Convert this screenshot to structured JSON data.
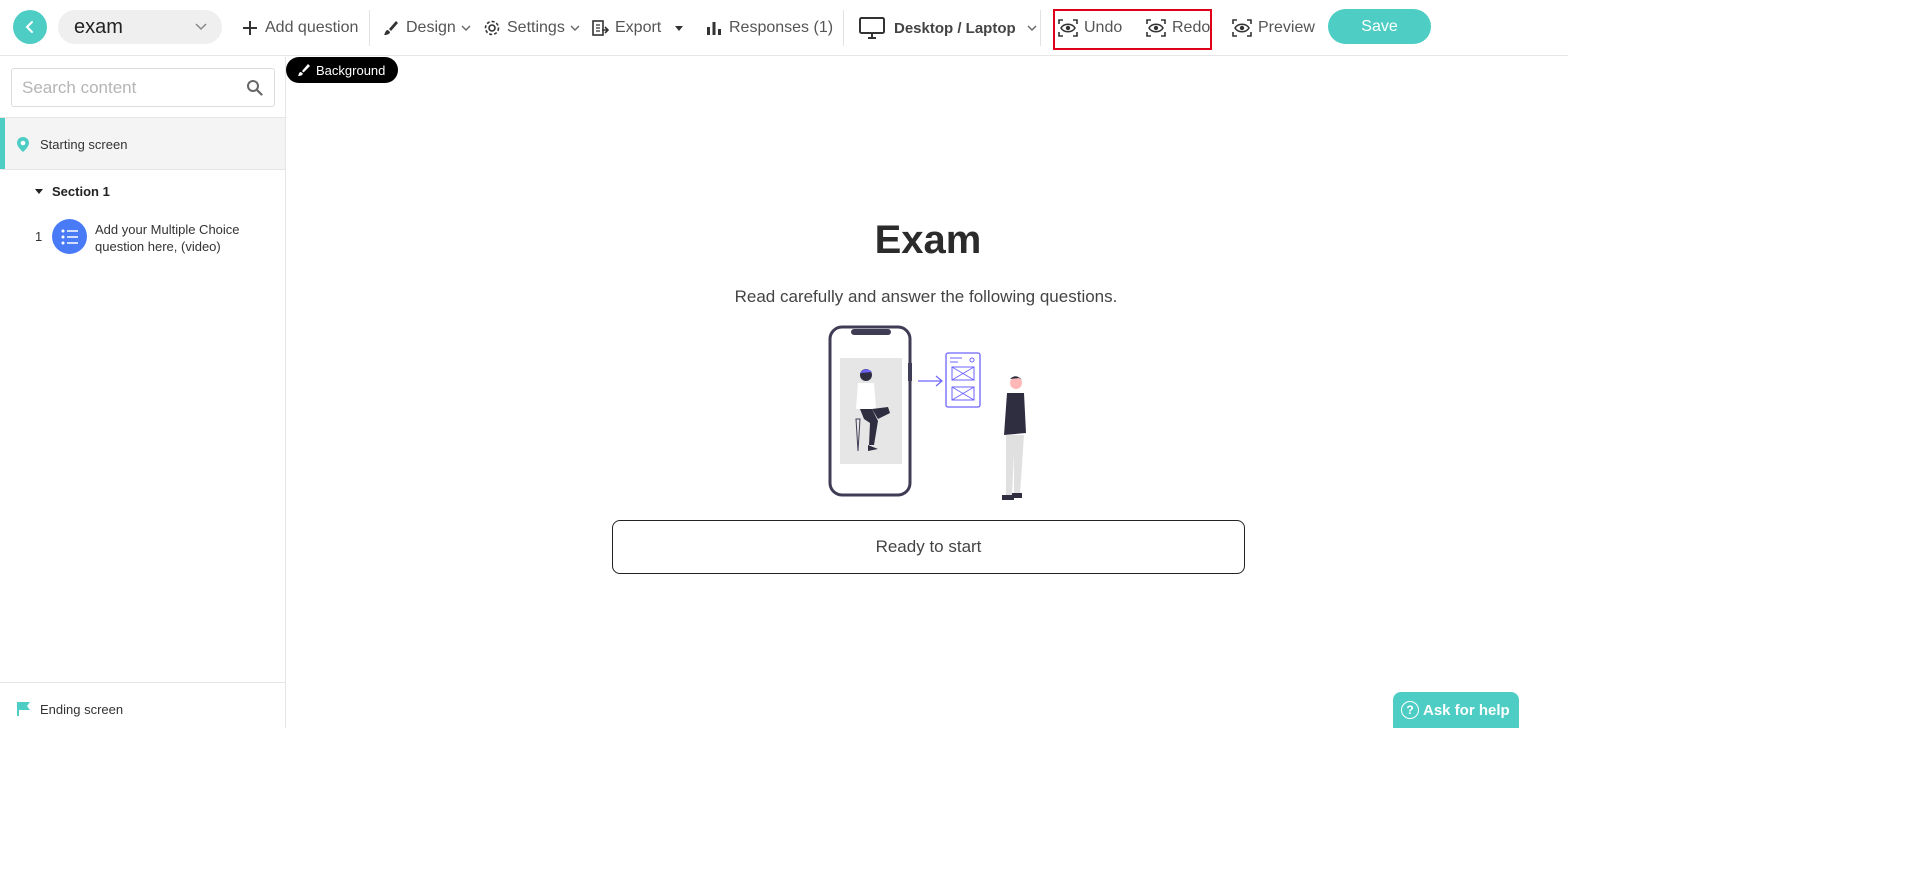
{
  "header": {
    "title_value": "exam",
    "add_question": "Add question",
    "design": "Design",
    "settings": "Settings",
    "export": "Export",
    "responses": "Responses (1)",
    "device": "Desktop / Laptop",
    "undo": "Undo",
    "redo": "Redo",
    "preview": "Preview",
    "save": "Save"
  },
  "sidebar": {
    "search_placeholder": "Search content",
    "starting_screen": "Starting screen",
    "section_label": "Section 1",
    "questions": [
      {
        "number": "1",
        "text": "Add your Multiple Choice question here, (video)"
      }
    ],
    "ending_screen": "Ending screen"
  },
  "main": {
    "background_tag": "Background",
    "title": "Exam",
    "subtitle": "Read carefully and answer the following questions.",
    "start_button": "Ready to start"
  },
  "help": {
    "label": "Ask for help"
  },
  "colors": {
    "accent": "#4ecdc4",
    "question_icon": "#4a7bf7",
    "highlight": "#e0001a"
  }
}
